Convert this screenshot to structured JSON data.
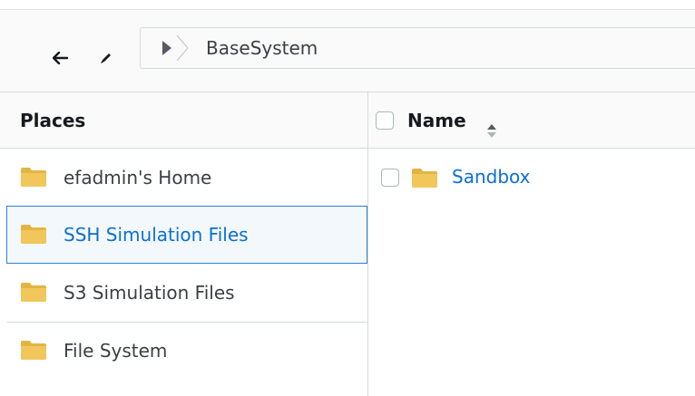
{
  "toolbar": {
    "back_icon": "arrow-left-icon",
    "edit_icon": "pencil-icon",
    "path_toggle_icon": "caret-right-icon",
    "breadcrumb": [
      "BaseSystem"
    ]
  },
  "places": {
    "title": "Places",
    "items": [
      {
        "label": "efadmin's Home",
        "icon": "folder-icon",
        "selected": false
      },
      {
        "label": "SSH Simulation Files",
        "icon": "folder-icon",
        "selected": true
      },
      {
        "label": "S3 Simulation Files",
        "icon": "folder-icon",
        "selected": false
      },
      {
        "label": "File System",
        "icon": "folder-icon",
        "selected": false
      }
    ]
  },
  "files": {
    "columns": [
      {
        "label": "Name",
        "sort_icon": "sort-icon"
      }
    ],
    "rows": [
      {
        "name": "Sandbox",
        "type": "folder",
        "checked": false
      }
    ]
  },
  "colors": {
    "accent": "#0b6fd3",
    "selected_border": "#2f7fd8",
    "folder": "#f1c75b",
    "divider": "#d5dbdb"
  }
}
